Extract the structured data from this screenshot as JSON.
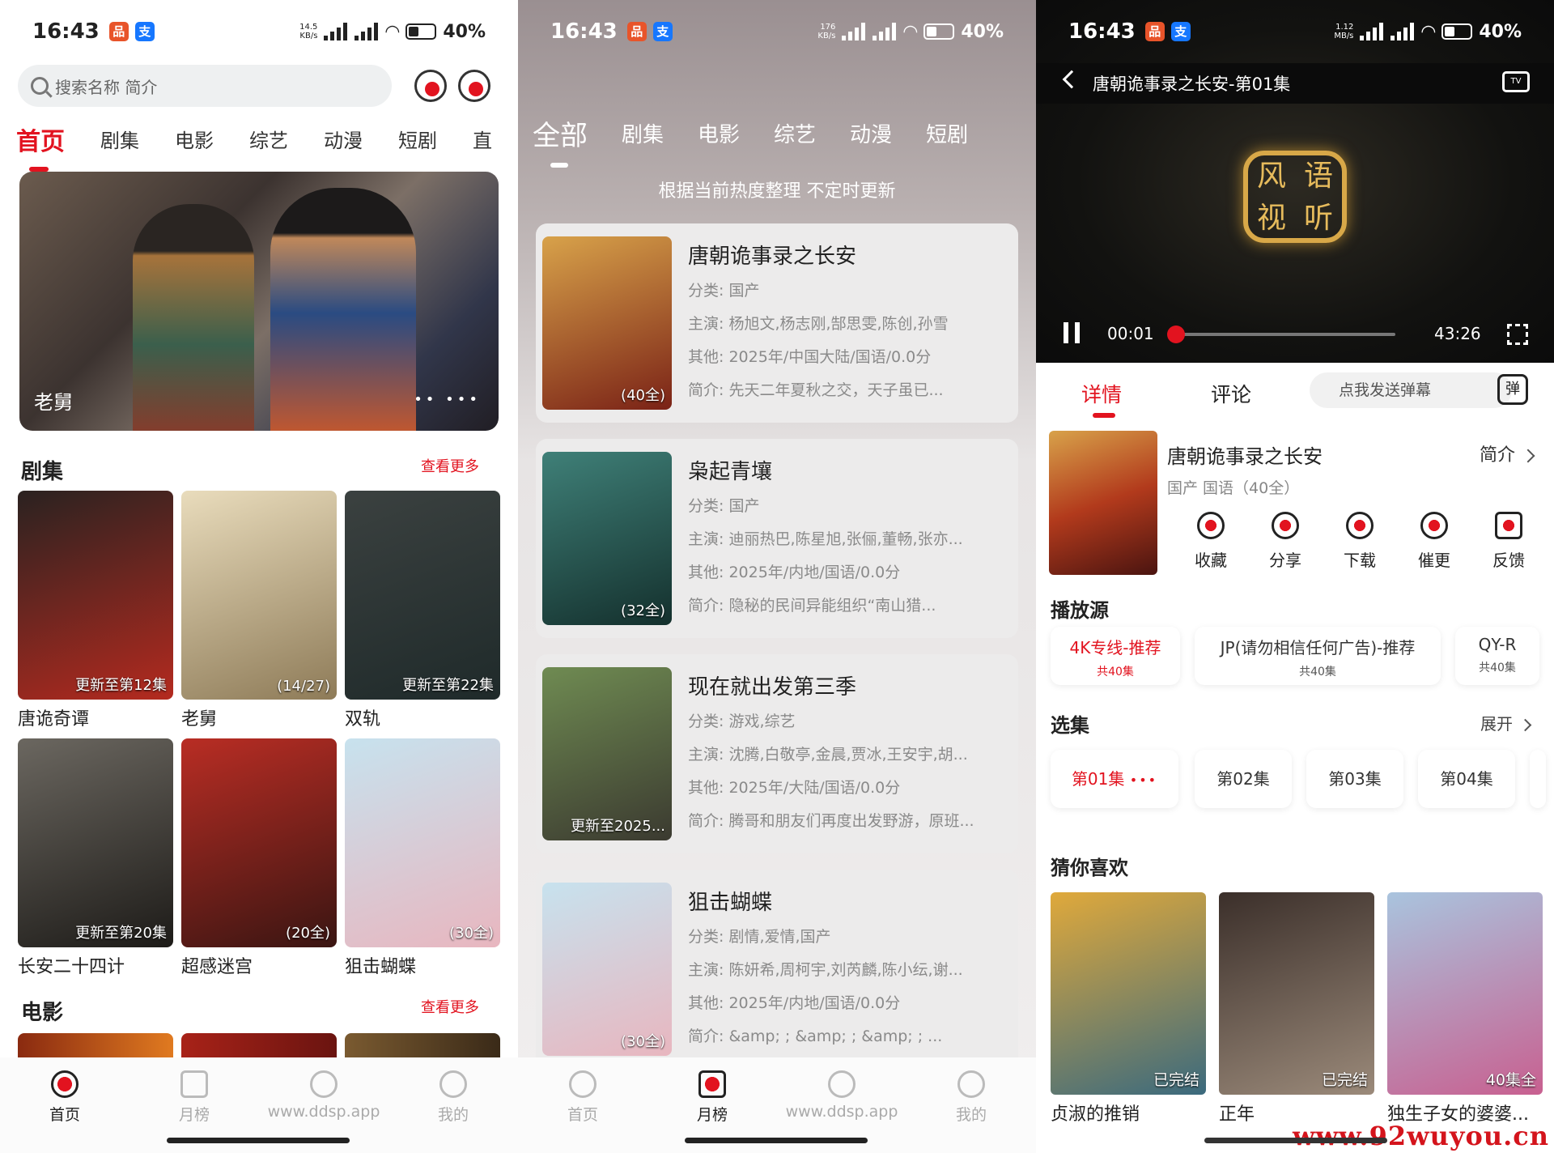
{
  "status": {
    "time": "16:43",
    "battery": "40%",
    "net1": [
      "14.5",
      "KB/s"
    ],
    "net2": [
      "176",
      "KB/s"
    ],
    "net3": [
      "1.12",
      "MB/s"
    ],
    "signal": "4G"
  },
  "home": {
    "search_placeholder": "搜索名称 简介",
    "categories": [
      "首页",
      "剧集",
      "电影",
      "综艺",
      "动漫",
      "短剧",
      "直"
    ],
    "hero_caption": "老舅",
    "hero_dots": "•• •••",
    "series_title": "剧集",
    "movie_title": "电影",
    "more": "查看更多",
    "posters": [
      {
        "name": "唐诡奇谭",
        "badge": "更新至第12集",
        "c1": "#2a2220",
        "c2": "#b42a1f"
      },
      {
        "name": "老舅",
        "badge": "(14/27)",
        "c1": "#e9dcbc",
        "c2": "#8e7b58"
      },
      {
        "name": "双轨",
        "badge": "更新至第22集",
        "c1": "#3b4140",
        "c2": "#1f2a2a"
      },
      {
        "name": "长安二十四计",
        "badge": "更新至第20集",
        "c1": "#6b6760",
        "c2": "#1d1b18"
      },
      {
        "name": "超感迷宫",
        "badge": "(20全)",
        "c1": "#b92d24",
        "c2": "#3a1512"
      },
      {
        "name": "狙击蝴蝶",
        "badge": "(30全)",
        "c1": "#c7e2ee",
        "c2": "#e8b6bf"
      }
    ],
    "nav": [
      "首页",
      "月榜",
      "www.ddsp.app",
      "我的"
    ]
  },
  "rank": {
    "tabs": [
      "全部",
      "剧集",
      "电影",
      "综艺",
      "动漫",
      "短剧"
    ],
    "notice": "根据当前热度整理 不定时更新",
    "items": [
      {
        "title": "唐朝诡事录之长安",
        "badge": "(40全)",
        "cat": "分类: 国产",
        "cast": "主演: 杨旭文,杨志刚,郜思雯,陈创,孙雪",
        "other": "其他: 2025年/中国大陆/国语/0.0分",
        "intro": "简介:      先天二年夏秋之交，天子虽已...",
        "c1": "#d8a24a",
        "c2": "#7a2216"
      },
      {
        "title": "枭起青壤",
        "badge": "(32全)",
        "cat": "分类: 国产",
        "cast": "主演: 迪丽热巴,陈星旭,张俪,董畅,张亦...",
        "other": "其他: 2025年/内地/国语/0.0分",
        "intro": "简介:      隐秘的民间异能组织“南山猎...",
        "c1": "#3f8078",
        "c2": "#14302d"
      },
      {
        "title": "现在就出发第三季",
        "badge": "更新至2025...",
        "cat": "分类: 游戏,综艺",
        "cast": "主演: 沈腾,白敬亭,金晨,贾冰,王安宇,胡...",
        "other": "其他: 2025年/大陆/国语/0.0分",
        "intro": "简介: 腾哥和朋友们再度出发野游，原班...",
        "c1": "#6f8b52",
        "c2": "#3b3a30"
      },
      {
        "title": "狙击蝴蝶",
        "badge": "(30全)",
        "cat": "分类: 剧情,爱情,国产",
        "cast": "主演: 陈妍希,周柯宇,刘芮麟,陈小纭,谢...",
        "other": "其他: 2025年/内地/国语/0.0分",
        "intro": "简介: &amp;    ; &amp;    ; &amp;    ; ...",
        "c1": "#c7e2ee",
        "c2": "#e8b6bf"
      }
    ],
    "nav": [
      "首页",
      "月榜",
      "www.ddsp.app",
      "我的"
    ]
  },
  "detail": {
    "player_title": "唐朝诡事录之长安-第01集",
    "tv": "TV",
    "logo": [
      "风",
      "语",
      "视",
      "听"
    ],
    "time_cur": "00:01",
    "time_total": "43:26",
    "progress": 0.0004,
    "tabs": [
      "详情",
      "评论"
    ],
    "danmu": "点我发送弹幕",
    "danmu_icon": "弹",
    "title": "唐朝诡事录之长安",
    "sub": "国产 国语（40全）",
    "intro": "简介",
    "actions": [
      "收藏",
      "分享",
      "下载",
      "催更",
      "反馈"
    ],
    "source_title": "播放源",
    "sources": [
      {
        "name": "4K专线-推荐",
        "count": "共40集"
      },
      {
        "name": "JP(请勿相信任何广告)-推荐",
        "count": "共40集"
      },
      {
        "name": "QY-R",
        "count": "共40集"
      }
    ],
    "episode_title": "选集",
    "expand": "展开",
    "episodes": [
      "第01集",
      "第02集",
      "第03集",
      "第04集"
    ],
    "playing_dots": "•••",
    "recommend_title": "猜你喜欢",
    "recommend": [
      {
        "name": "贞淑的推销",
        "badge": "已完结",
        "c1": "#e0a93b",
        "c2": "#3b6a7e"
      },
      {
        "name": "正年",
        "badge": "已完结",
        "c1": "#3b2f2a",
        "c2": "#9b8a7a"
      },
      {
        "name": "独生子女的婆婆...",
        "badge": "40集全",
        "c1": "#a9c4de",
        "c2": "#c86090"
      }
    ],
    "watermark": "www.92wuyou.cn"
  }
}
